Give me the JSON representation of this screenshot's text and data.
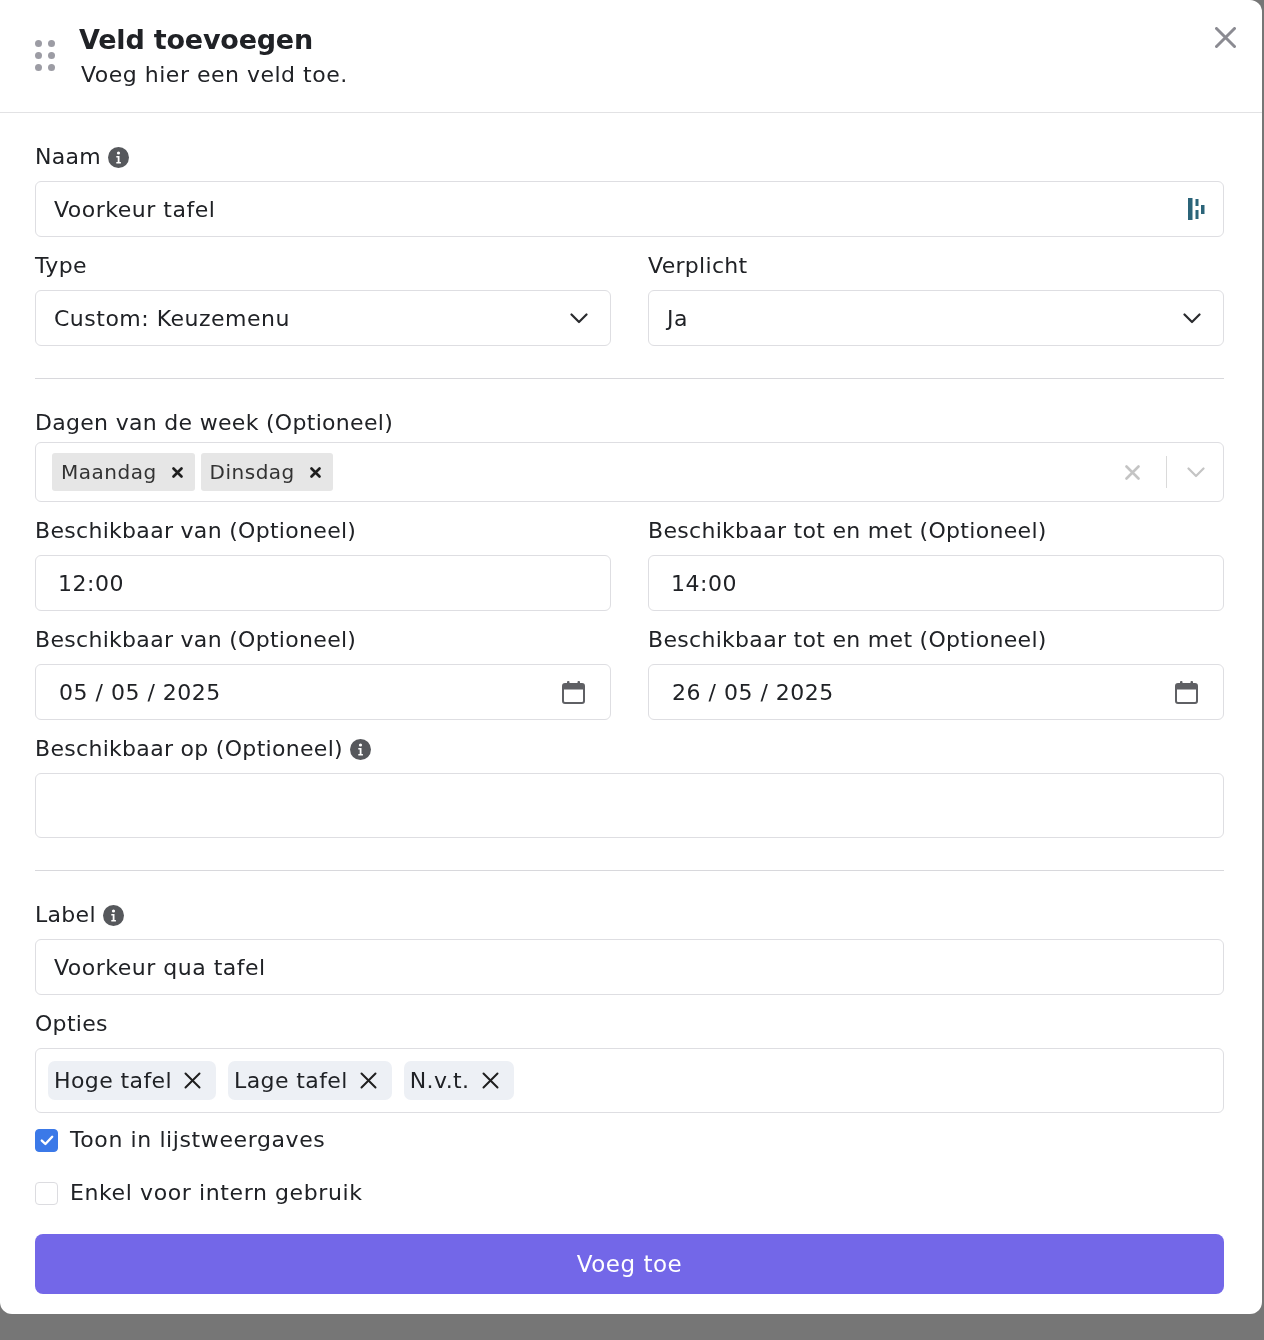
{
  "dialog": {
    "title": "Veld toevoegen",
    "subtitle": "Voeg hier een veld toe."
  },
  "sections": [
    {
      "rows": [
        [
          {
            "kind": "text",
            "label": "Naam",
            "info": true,
            "value": "Voorkeur tafel",
            "autofill_icon": true
          }
        ],
        [
          {
            "kind": "select",
            "label": "Type",
            "value": "Custom: Keuzemenu"
          },
          {
            "kind": "select",
            "label": "Verplicht",
            "value": "Ja"
          }
        ]
      ]
    },
    {
      "rows": [
        [
          {
            "kind": "multiselect",
            "label": "Dagen van de week (Optioneel)",
            "tags": [
              "Maandag",
              "Dinsdag"
            ]
          }
        ],
        [
          {
            "kind": "time",
            "label": "Beschikbaar van (Optioneel)",
            "value": "12:00"
          },
          {
            "kind": "time",
            "label": "Beschikbaar tot en met (Optioneel)",
            "value": "14:00"
          }
        ],
        [
          {
            "kind": "date",
            "label": "Beschikbaar van (Optioneel)",
            "value": "05 / 05 / 2025"
          },
          {
            "kind": "date",
            "label": "Beschikbaar tot en met (Optioneel)",
            "value": "26 / 05 / 2025"
          }
        ],
        [
          {
            "kind": "tags",
            "label": "Beschikbaar op (Optioneel)",
            "info": true
          }
        ]
      ]
    },
    {
      "rows": [
        [
          {
            "kind": "text",
            "label": "Label",
            "info": true,
            "value": "Voorkeur qua tafel"
          }
        ],
        [
          {
            "kind": "tags",
            "label": "Opties",
            "tags": [
              "Hoge tafel",
              "Lage tafel",
              "N.v.t."
            ]
          }
        ]
      ]
    }
  ],
  "checkboxes": [
    {
      "label": "Toon in lijstweergaves",
      "checked": true
    },
    {
      "label": "Enkel voor intern gebruik",
      "checked": false
    }
  ],
  "submit": {
    "label": "Voeg toe"
  }
}
